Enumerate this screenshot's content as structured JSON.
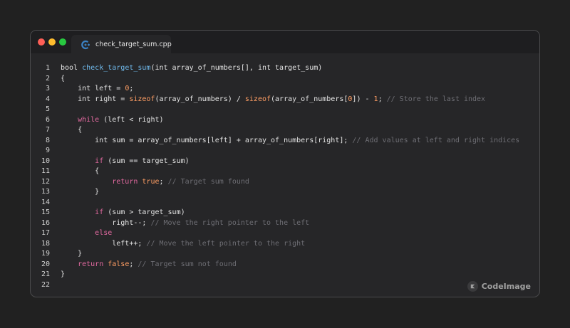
{
  "window": {
    "tab": {
      "label": "check_target_sum.cpp",
      "icon": "cpp-file-icon",
      "icon_color": "#3b82c4"
    },
    "traffic_lights": {
      "close_color": "#fe5f57",
      "minimize_color": "#febc2e",
      "maximize_color": "#28c840"
    }
  },
  "brand": {
    "label": "CodeImage",
    "icon": "codeimage-logo-icon"
  },
  "theme": {
    "background": "#212121",
    "window_bg": "#262628",
    "keyword": "#e36aa1",
    "function": "#6fb8ea",
    "number": "#ff9e64",
    "comment": "#6e6e74",
    "text": "#e3e3e3"
  },
  "code": {
    "lines": [
      {
        "n": "1",
        "tokens": [
          {
            "t": "bool ",
            "c": "plain"
          },
          {
            "t": "check_target_sum",
            "c": "fn"
          },
          {
            "t": "(int array_of_numbers[], int target_sum)",
            "c": "plain"
          }
        ]
      },
      {
        "n": "2",
        "tokens": [
          {
            "t": "{",
            "c": "plain"
          }
        ]
      },
      {
        "n": "3",
        "tokens": [
          {
            "t": "    int left = ",
            "c": "plain"
          },
          {
            "t": "0",
            "c": "num"
          },
          {
            "t": ";",
            "c": "plain"
          }
        ]
      },
      {
        "n": "4",
        "tokens": [
          {
            "t": "    int right = ",
            "c": "plain"
          },
          {
            "t": "sizeof",
            "c": "builtin"
          },
          {
            "t": "(array_of_numbers) / ",
            "c": "plain"
          },
          {
            "t": "sizeof",
            "c": "builtin"
          },
          {
            "t": "(array_of_numbers[",
            "c": "plain"
          },
          {
            "t": "0",
            "c": "num"
          },
          {
            "t": "]) - ",
            "c": "plain"
          },
          {
            "t": "1",
            "c": "num"
          },
          {
            "t": "; ",
            "c": "plain"
          },
          {
            "t": "// Store the last index",
            "c": "comment"
          }
        ]
      },
      {
        "n": "5",
        "tokens": []
      },
      {
        "n": "6",
        "tokens": [
          {
            "t": "    ",
            "c": "plain"
          },
          {
            "t": "while",
            "c": "kw"
          },
          {
            "t": " (left < right)",
            "c": "plain"
          }
        ]
      },
      {
        "n": "7",
        "tokens": [
          {
            "t": "    {",
            "c": "plain"
          }
        ]
      },
      {
        "n": "8",
        "tokens": [
          {
            "t": "        int sum = array_of_numbers[left] + array_of_numbers[right]; ",
            "c": "plain"
          },
          {
            "t": "// Add values at left and right indices",
            "c": "comment"
          }
        ]
      },
      {
        "n": "9",
        "tokens": []
      },
      {
        "n": "10",
        "tokens": [
          {
            "t": "        ",
            "c": "plain"
          },
          {
            "t": "if",
            "c": "kw"
          },
          {
            "t": " (sum == target_sum)",
            "c": "plain"
          }
        ]
      },
      {
        "n": "11",
        "tokens": [
          {
            "t": "        {",
            "c": "plain"
          }
        ]
      },
      {
        "n": "12",
        "tokens": [
          {
            "t": "            ",
            "c": "plain"
          },
          {
            "t": "return",
            "c": "kw"
          },
          {
            "t": " ",
            "c": "plain"
          },
          {
            "t": "true",
            "c": "bool"
          },
          {
            "t": "; ",
            "c": "plain"
          },
          {
            "t": "// Target sum found",
            "c": "comment"
          }
        ]
      },
      {
        "n": "13",
        "tokens": [
          {
            "t": "        }",
            "c": "plain"
          }
        ]
      },
      {
        "n": "14",
        "tokens": []
      },
      {
        "n": "15",
        "tokens": [
          {
            "t": "        ",
            "c": "plain"
          },
          {
            "t": "if",
            "c": "kw"
          },
          {
            "t": " (sum > target_sum)",
            "c": "plain"
          }
        ]
      },
      {
        "n": "16",
        "tokens": [
          {
            "t": "            right--; ",
            "c": "plain"
          },
          {
            "t": "// Move the right pointer to the left",
            "c": "comment"
          }
        ]
      },
      {
        "n": "17",
        "tokens": [
          {
            "t": "        ",
            "c": "plain"
          },
          {
            "t": "else",
            "c": "kw"
          }
        ]
      },
      {
        "n": "18",
        "tokens": [
          {
            "t": "            left++; ",
            "c": "plain"
          },
          {
            "t": "// Move the left pointer to the right",
            "c": "comment"
          }
        ]
      },
      {
        "n": "19",
        "tokens": [
          {
            "t": "    }",
            "c": "plain"
          }
        ]
      },
      {
        "n": "20",
        "tokens": [
          {
            "t": "    ",
            "c": "plain"
          },
          {
            "t": "return",
            "c": "kw"
          },
          {
            "t": " ",
            "c": "plain"
          },
          {
            "t": "false",
            "c": "bool"
          },
          {
            "t": "; ",
            "c": "plain"
          },
          {
            "t": "// Target sum not found",
            "c": "comment"
          }
        ]
      },
      {
        "n": "21",
        "tokens": [
          {
            "t": "}",
            "c": "plain"
          }
        ]
      },
      {
        "n": "22",
        "tokens": []
      }
    ]
  }
}
